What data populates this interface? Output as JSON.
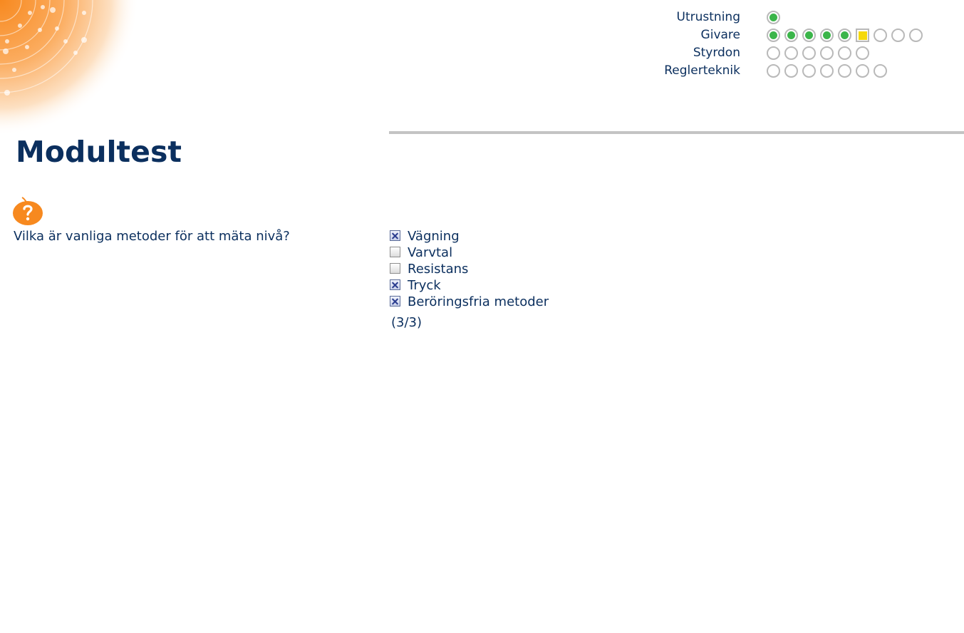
{
  "progress": {
    "rows": [
      {
        "label": "Utrustning",
        "dots": [
          "done"
        ]
      },
      {
        "label": "Givare",
        "dots": [
          "done",
          "done",
          "done",
          "done",
          "done",
          "current",
          "empty",
          "empty",
          "empty"
        ]
      },
      {
        "label": "Styrdon",
        "dots": [
          "empty",
          "empty",
          "empty",
          "empty",
          "empty",
          "empty"
        ]
      },
      {
        "label": "Reglerteknik",
        "dots": [
          "empty",
          "empty",
          "empty",
          "empty",
          "empty",
          "empty",
          "empty"
        ]
      }
    ]
  },
  "page": {
    "title": "Modultest"
  },
  "quiz": {
    "question": "Vilka är vanliga metoder för att mäta nivå?",
    "answers": [
      {
        "label": "Vägning",
        "checked": true
      },
      {
        "label": "Varvtal",
        "checked": false
      },
      {
        "label": "Resistans",
        "checked": false
      },
      {
        "label": "Tryck",
        "checked": true
      },
      {
        "label": "Beröringsfria metoder",
        "checked": true
      }
    ],
    "score": "(3/3)"
  },
  "icons": {
    "help": "help-apple-icon",
    "decoration": "orange-circles-decoration"
  },
  "colors": {
    "text": "#0b2f5e",
    "done": "#3bb54a",
    "current": "#f5d90a",
    "accent": "#f7891f"
  }
}
